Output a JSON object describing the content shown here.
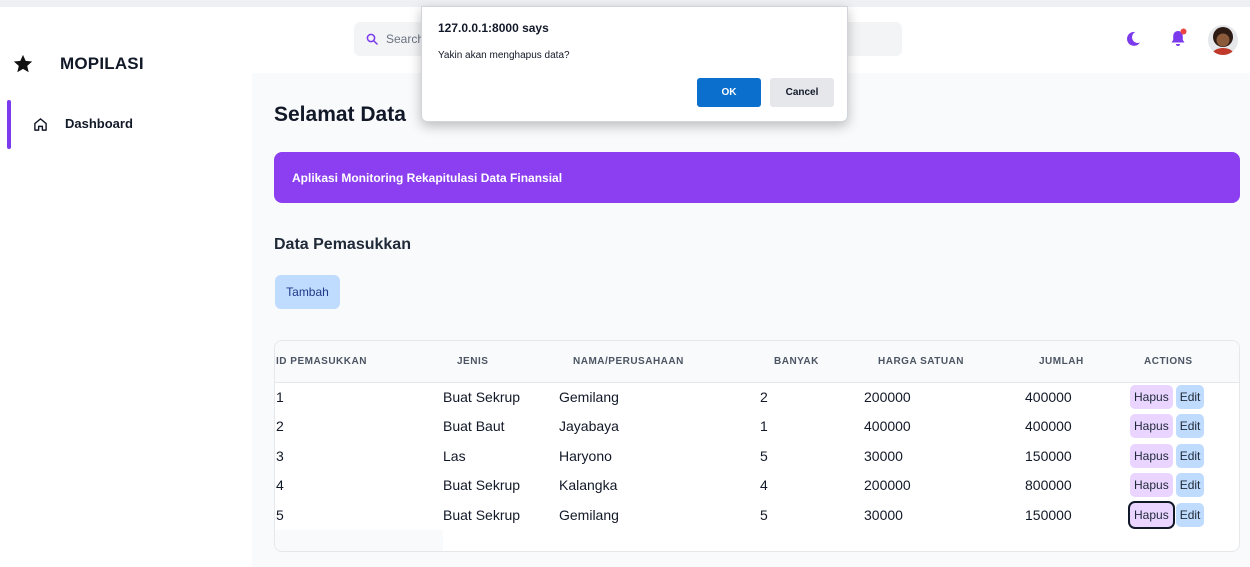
{
  "app": {
    "brand_name": "MOPILASI",
    "brand_icon": "star-icon"
  },
  "sidebar": {
    "items": [
      {
        "label": "Dashboard",
        "icon": "home-icon",
        "active": true
      }
    ]
  },
  "header": {
    "search_placeholder": "Search",
    "icons": [
      "search-icon",
      "moon-icon",
      "bell-icon",
      "avatar"
    ],
    "notification_dot_color": "#ef4444"
  },
  "main": {
    "page_title": "Selamat Data",
    "banner_text": "Aplikasi Monitoring Rekapitulasi Data Finansial",
    "section_title": "Data Pemasukkan",
    "add_button": "Tambah",
    "table": {
      "columns": [
        "ID PEMASUKKAN",
        "JENIS",
        "NAMA/PERUSAHAAN",
        "BANYAK",
        "HARGA SATUAN",
        "JUMLAH",
        "ACTIONS"
      ],
      "rows": [
        [
          "1",
          "Buat Sekrup",
          "Gemilang",
          "2",
          "200000",
          "400000"
        ],
        [
          "2",
          "Buat Baut",
          "Jayabaya",
          "1",
          "400000",
          "400000"
        ],
        [
          "3",
          "Las",
          "Haryono",
          "5",
          "30000",
          "150000"
        ],
        [
          "4",
          "Buat Sekrup",
          "Kalangka",
          "4",
          "200000",
          "800000"
        ],
        [
          "5",
          "Buat Sekrup",
          "Gemilang",
          "5",
          "30000",
          "150000"
        ]
      ],
      "delete_label": "Hapus",
      "edit_label": "Edit"
    }
  },
  "dialog": {
    "title": "127.0.0.1:8000 says",
    "message": "Yakin akan menghapus data?",
    "ok_label": "OK",
    "cancel_label": "Cancel"
  },
  "colors": {
    "accent": "#8b3ff0",
    "sidebar_active": "#7c3aed",
    "dialog_ok": "#0b6fcd",
    "delete_button": "#e9d5ff",
    "edit_button": "#bfdbfe"
  }
}
